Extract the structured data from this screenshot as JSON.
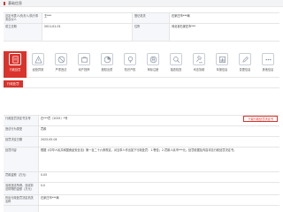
{
  "header": {
    "title": "基础信息"
  },
  "info": {
    "row1": {
      "label1": "法定代表人/负责人/执行事务合伙人",
      "value1": "王***",
      "label2": "登记机关",
      "value2": "石家庄市***局"
    },
    "row2": {
      "label1": "成立日期",
      "value1": "2011-01-01",
      "label2": "住所",
      "value2": "河北省石家庄市***"
    },
    "row3": {
      "label1": "",
      "value1": ""
    }
  },
  "tabs": [
    {
      "label": "行政处罚",
      "icon": "document-icon",
      "active": true
    },
    {
      "label": "经营异常",
      "icon": "warning-icon",
      "active": false
    },
    {
      "label": "严重违法",
      "icon": "stop-icon",
      "active": false
    },
    {
      "label": "动产抵押",
      "icon": "pledge-icon",
      "active": false
    },
    {
      "label": "股权出质",
      "icon": "equity-icon",
      "active": false
    },
    {
      "label": "知识产权",
      "icon": "ip-icon",
      "active": false
    },
    {
      "label": "商标注册",
      "icon": "trademark-icon",
      "active": false
    },
    {
      "label": "抽查检查",
      "icon": "search-icon",
      "active": false
    },
    {
      "label": "司法协助",
      "icon": "gavel-icon",
      "active": false
    },
    {
      "label": "年报信息",
      "icon": "report-icon",
      "active": false
    },
    {
      "label": "变更信息",
      "icon": "edit-icon",
      "active": false
    },
    {
      "label": "其他信息",
      "icon": "more-icon",
      "active": false
    }
  ],
  "subtab": {
    "label": "行政处罚"
  },
  "proof_button": "下载行政处罚决定书",
  "detail": [
    {
      "label": "行政处罚决定书文号",
      "value": "石***罚〔2025〕*号"
    },
    {
      "label": "违法行为类型",
      "value": "罚款"
    },
    {
      "label": "处罚决定日期",
      "value": "2025-05-04"
    },
    {
      "label": "处罚内容",
      "value": "根据《中华人民共和国食品安全法》第一百二十六条规定，对当事人作出如下行政处罚：1.警告；2.罚款人民币***元。处罚依据及内容详见行政处罚决定书。"
    },
    {
      "label": "罚款金额（万元）",
      "value": "0.05"
    },
    {
      "label": "没收违法所得、没收非法财物的金额（万元）",
      "value": "0.0"
    },
    {
      "label": "作出行政处罚决定机关名称",
      "value": "石家庄市***局"
    },
    {
      "label": "",
      "value": ""
    }
  ]
}
